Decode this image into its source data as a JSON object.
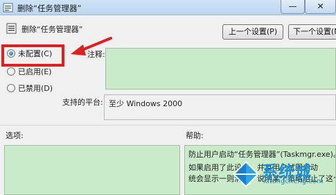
{
  "window": {
    "title": "删除“任务管理器”",
    "minimize_glyph": "—",
    "close_glyph": "✕"
  },
  "header": {
    "policy_title": "删除“任务管理器”",
    "prev_button": "上一个设置(P)",
    "next_button": "下一个设置(N)"
  },
  "options": {
    "not_configured": "未配置(C)",
    "enabled": "已启用(E)",
    "disabled": "已禁用(D)",
    "selected": "not_configured"
  },
  "comment": {
    "label": "注释:"
  },
  "platform": {
    "label": "支持的平台:",
    "value": "至少 Windows 2000"
  },
  "panes": {
    "options_label": "选项:",
    "help_label": "帮助:",
    "help_text_lines": [
      "防止用户启动“任务管理器”(Taskmgr.exe)。",
      "如果启用了此设置，并且用户试图启动",
      "统会显示一则消息，说明某个策略阻止了这个操作"
    ]
  },
  "watermark": {
    "name": "系统城",
    "url": "xitongcheng.com"
  },
  "colors": {
    "annotation_red": "#e02020",
    "pane_green": "#c9ebc9",
    "watermark_blue": "#1d8fd6"
  }
}
